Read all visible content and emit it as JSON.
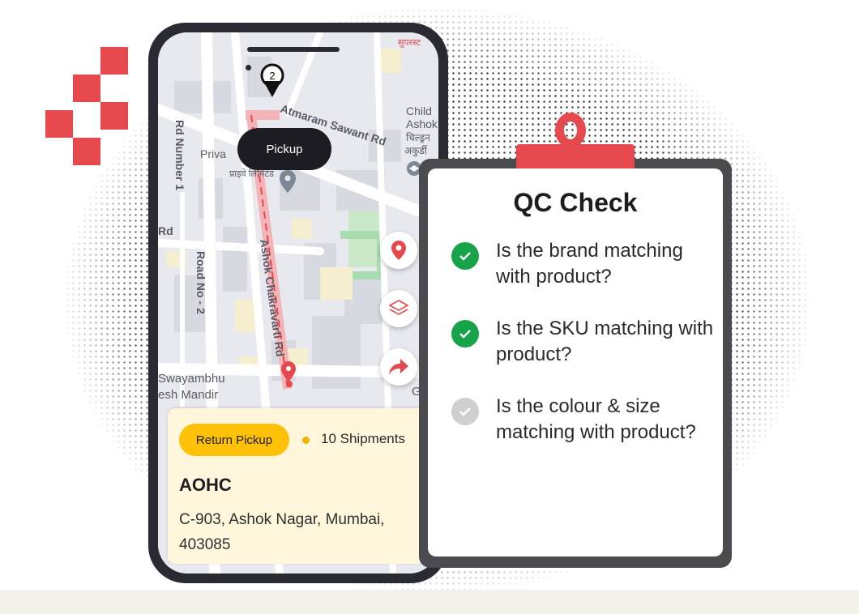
{
  "map": {
    "labels": {
      "road_top": "Atmaram Sawant Rd",
      "rd_number_1": "Rd Number 1",
      "road_no_2": "Road No - 2",
      "ashok_rd": "Ashok Chakravarti Rd",
      "priva": "Priva",
      "priva_hindi": "प्राइवे लिमिटेड",
      "child_1": "Child",
      "child_2": "Ashok",
      "child_hindi": "चिल्ड्रन",
      "akurdi_hindi": "अकुर्डी",
      "top_hindi": "सुपरस्ट",
      "rd_left": "Rd",
      "swayambhu_1": "Swayambhu",
      "swayambhu_2": "esh Mandir",
      "edge_g": "G"
    },
    "marker_number": "2",
    "pickup_label": "Pickup"
  },
  "card": {
    "badge": "Return Pickup",
    "shipments": "10 Shipments",
    "name": "AOHC",
    "address": "C-903, Ashok Nagar, Mumbai, 403085"
  },
  "qc": {
    "title": "QC Check",
    "items": [
      {
        "text": "Is the brand matching with product?",
        "status": "checked"
      },
      {
        "text": "Is the SKU matching with product?",
        "status": "checked"
      },
      {
        "text": "Is the colour & size matching with product?",
        "status": "pending"
      }
    ]
  },
  "colors": {
    "accent_red": "#e5484d",
    "check_green": "#16a34a",
    "pending_grey": "#cfcfd2",
    "badge_yellow": "#ffc107"
  }
}
